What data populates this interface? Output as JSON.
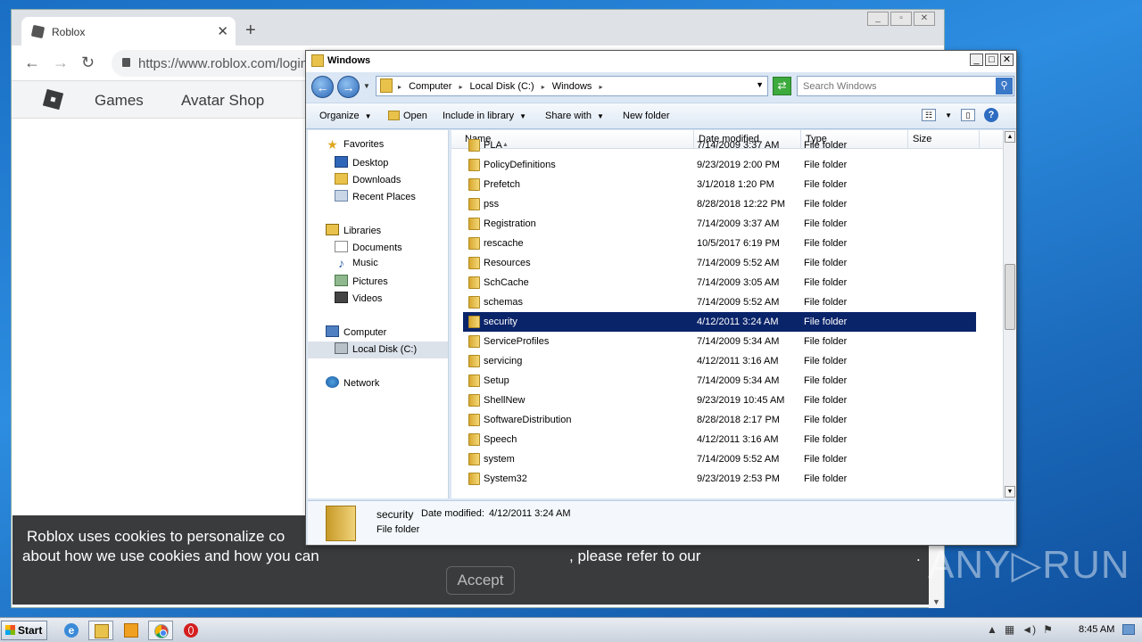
{
  "chrome": {
    "tab_title": "Roblox",
    "tab_close": "✕",
    "newtab": "+",
    "url": "https://www.roblox.com/login",
    "nav_back": "←",
    "nav_forward": "→",
    "nav_reload": "↻",
    "site_nav": [
      "Games",
      "Avatar Shop"
    ],
    "cookie_banner": {
      "line1": "Roblox uses cookies to personalize co",
      "line2a": "about how we use cookies and how you can",
      "line2b": ", please refer to our",
      "trail": ".",
      "accept": "Accept"
    }
  },
  "explorer": {
    "title": "Windows",
    "breadcrumb": [
      "Computer",
      "Local Disk (C:)",
      "Windows"
    ],
    "search_placeholder": "Search Windows",
    "commands": {
      "organize": "Organize",
      "open": "Open",
      "include": "Include in library",
      "share": "Share with",
      "newfolder": "New folder"
    },
    "nav_pane": {
      "favorites": "Favorites",
      "desktop": "Desktop",
      "downloads": "Downloads",
      "recent": "Recent Places",
      "libraries": "Libraries",
      "documents": "Documents",
      "music": "Music",
      "pictures": "Pictures",
      "videos": "Videos",
      "computer": "Computer",
      "localdisk": "Local Disk (C:)",
      "network": "Network"
    },
    "columns": {
      "name": "Name",
      "date": "Date modified",
      "type": "Type",
      "size": "Size"
    },
    "files": [
      {
        "name": "PLA",
        "date": "7/14/2009 3:37 AM",
        "type": "File folder"
      },
      {
        "name": "PolicyDefinitions",
        "date": "9/23/2019 2:00 PM",
        "type": "File folder"
      },
      {
        "name": "Prefetch",
        "date": "3/1/2018 1:20 PM",
        "type": "File folder"
      },
      {
        "name": "pss",
        "date": "8/28/2018 12:22 PM",
        "type": "File folder"
      },
      {
        "name": "Registration",
        "date": "7/14/2009 3:37 AM",
        "type": "File folder"
      },
      {
        "name": "rescache",
        "date": "10/5/2017 6:19 PM",
        "type": "File folder"
      },
      {
        "name": "Resources",
        "date": "7/14/2009 5:52 AM",
        "type": "File folder"
      },
      {
        "name": "SchCache",
        "date": "7/14/2009 3:05 AM",
        "type": "File folder"
      },
      {
        "name": "schemas",
        "date": "7/14/2009 5:52 AM",
        "type": "File folder"
      },
      {
        "name": "security",
        "date": "4/12/2011 3:24 AM",
        "type": "File folder",
        "selected": true
      },
      {
        "name": "ServiceProfiles",
        "date": "7/14/2009 5:34 AM",
        "type": "File folder"
      },
      {
        "name": "servicing",
        "date": "4/12/2011 3:16 AM",
        "type": "File folder"
      },
      {
        "name": "Setup",
        "date": "7/14/2009 5:34 AM",
        "type": "File folder"
      },
      {
        "name": "ShellNew",
        "date": "9/23/2019 10:45 AM",
        "type": "File folder"
      },
      {
        "name": "SoftwareDistribution",
        "date": "8/28/2018 2:17 PM",
        "type": "File folder"
      },
      {
        "name": "Speech",
        "date": "4/12/2011 3:16 AM",
        "type": "File folder"
      },
      {
        "name": "system",
        "date": "7/14/2009 5:52 AM",
        "type": "File folder"
      },
      {
        "name": "System32",
        "date": "9/23/2019 2:53 PM",
        "type": "File folder"
      }
    ],
    "details": {
      "name": "security",
      "date_label": "Date modified:",
      "date_value": "4/12/2011 3:24 AM",
      "type": "File folder"
    },
    "selection_color": "#0a246a"
  },
  "watermark": "ANY▷RUN",
  "taskbar": {
    "start": "Start",
    "clock": "8:45 AM",
    "pinned_icons": [
      "ie-icon",
      "explorer-icon",
      "media-player-icon",
      "chrome-icon",
      "opera-icon"
    ]
  }
}
